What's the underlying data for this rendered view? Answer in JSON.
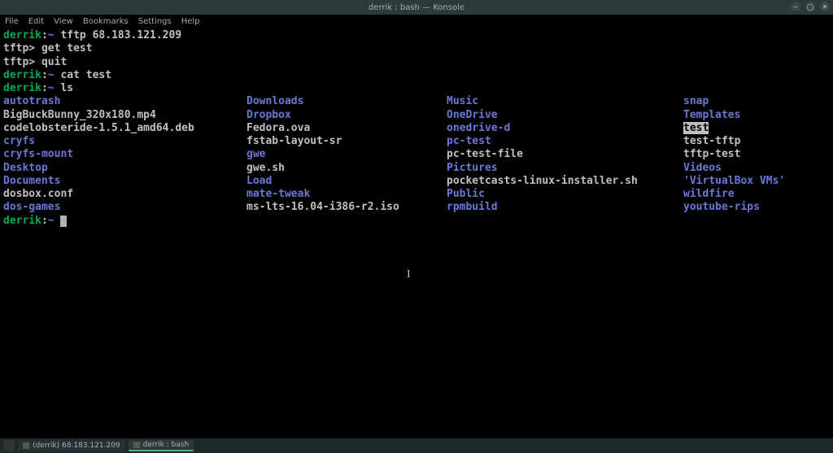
{
  "titlebar": {
    "title": "derrik : bash — Konsole"
  },
  "window_controls": {
    "minimize": "−",
    "maximize": "◯",
    "close": "✕"
  },
  "menu": {
    "items": [
      "File",
      "Edit",
      "View",
      "Bookmarks",
      "Settings",
      "Help"
    ]
  },
  "prompt": {
    "user": "derrik",
    "sep": ":",
    "path": "~",
    "tftp": "tftp>"
  },
  "commands": {
    "c1": "tftp 68.183.121.209",
    "c2": "get test",
    "c3": "quit",
    "c4": "cat test",
    "c5": "ls"
  },
  "ls": {
    "rows": [
      [
        "autotrash",
        "dir",
        "Downloads",
        "dir",
        "Music",
        "dir",
        "snap",
        "dir"
      ],
      [
        "BigBuckBunny_320x180.mp4",
        "file",
        "Dropbox",
        "dir",
        "OneDrive",
        "dir",
        "Templates",
        "dir"
      ],
      [
        "codelobsteride-1.5.1_amd64.deb",
        "file",
        "Fedora.ova",
        "file",
        "onedrive-d",
        "dir",
        "test",
        "highlighted"
      ],
      [
        "cryfs",
        "dir",
        "fstab-layout-sr",
        "file",
        "pc-test",
        "dir",
        "test-tftp",
        "file"
      ],
      [
        "cryfs-mount",
        "dir",
        "gwe",
        "dir",
        "pc-test-file",
        "file",
        "tftp-test",
        "file"
      ],
      [
        "Desktop",
        "dir",
        "gwe.sh",
        "file",
        "Pictures",
        "dir",
        "Videos",
        "dir"
      ],
      [
        "Documents",
        "dir",
        "Load",
        "dir",
        "pocketcasts-linux-installer.sh",
        "file",
        "'VirtualBox VMs'",
        "dir"
      ],
      [
        "dosbox.conf",
        "file",
        "mate-tweak",
        "dir",
        "Public",
        "dir",
        "wildfire",
        "dir"
      ],
      [
        "dos-games",
        "dir",
        "ms-lts-16.04-i386-r2.iso",
        "file",
        "rpmbuild",
        "dir",
        "youtube-rips",
        "dir"
      ]
    ]
  },
  "taskbar": {
    "items": [
      {
        "label": "(derrik) 68.183.121.209",
        "active": false
      },
      {
        "label": "derrik : bash",
        "active": true
      }
    ]
  }
}
